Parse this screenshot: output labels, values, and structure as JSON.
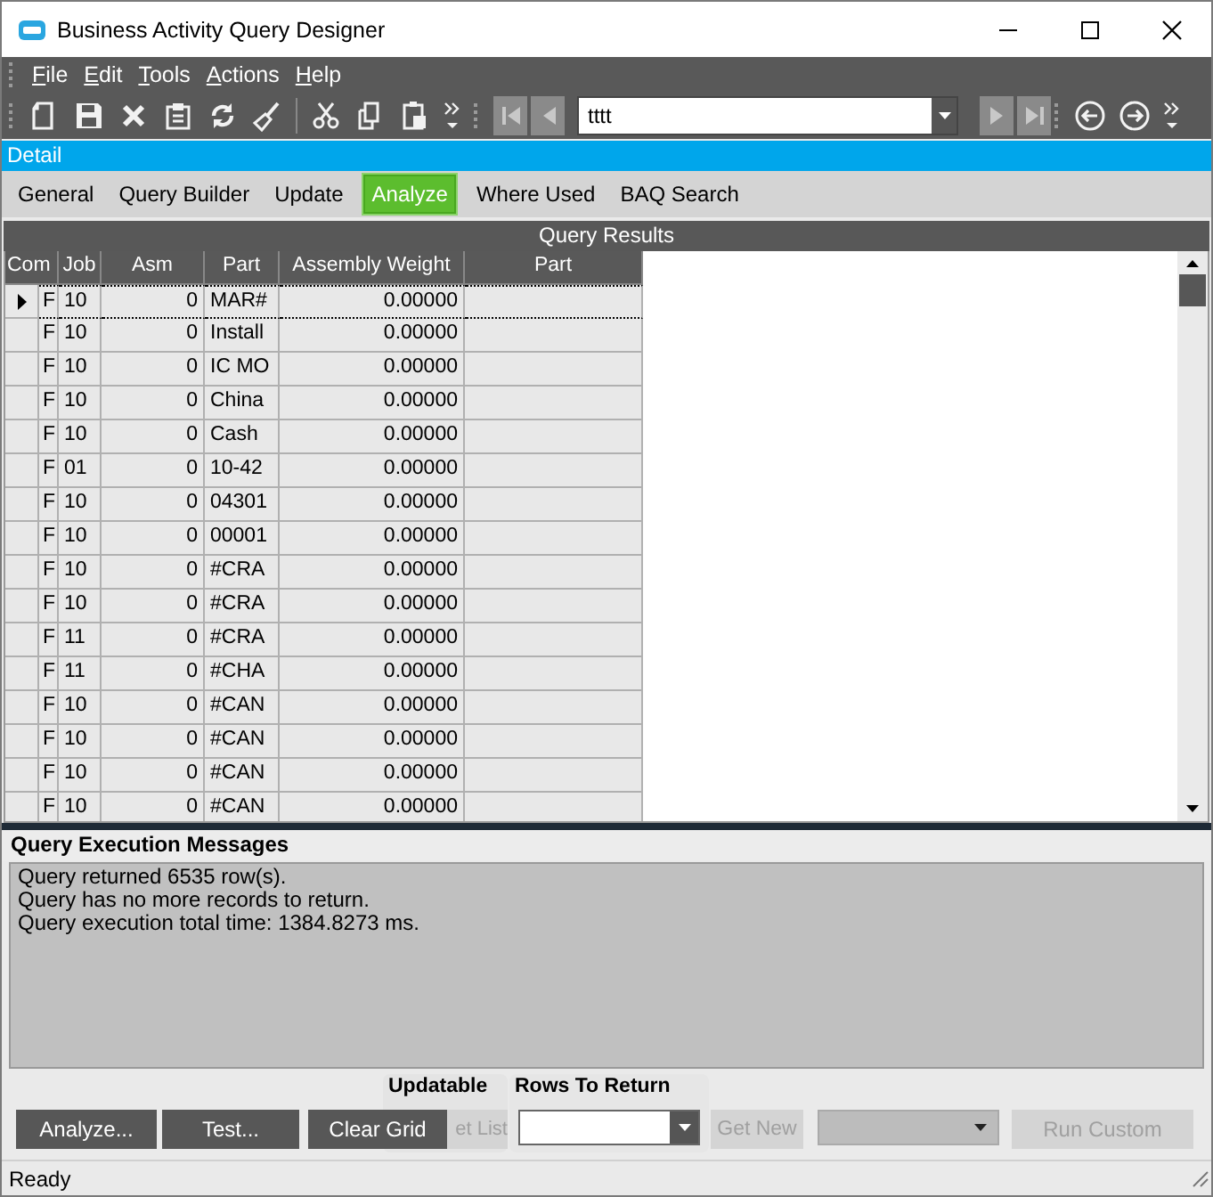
{
  "window": {
    "title": "Business Activity Query Designer"
  },
  "menu": [
    {
      "label": "File"
    },
    {
      "label": "Edit"
    },
    {
      "label": "Tools"
    },
    {
      "label": "Actions"
    },
    {
      "label": "Help"
    }
  ],
  "toolbar": {
    "record_field": {
      "value": "tttt"
    }
  },
  "section_bar": {
    "title": "Detail"
  },
  "tabs": [
    {
      "label": "General",
      "selected": false
    },
    {
      "label": "Query Builder",
      "selected": false
    },
    {
      "label": "Update",
      "selected": false
    },
    {
      "label": "Analyze",
      "selected": true
    },
    {
      "label": "Where Used",
      "selected": false
    },
    {
      "label": "BAQ Search",
      "selected": false
    }
  ],
  "results": {
    "title": "Query Results",
    "columns": [
      {
        "label": "Com"
      },
      {
        "label": "Job"
      },
      {
        "label": "Asm"
      },
      {
        "label": "Part"
      },
      {
        "label": "Assembly Weight"
      },
      {
        "label": "Part"
      }
    ],
    "rows": [
      {
        "current": true,
        "cells": [
          "F",
          "10",
          "0",
          "MAR#",
          "0.00000",
          ""
        ]
      },
      {
        "current": false,
        "cells": [
          "F",
          "10",
          "0",
          "Install",
          "0.00000",
          ""
        ]
      },
      {
        "current": false,
        "cells": [
          "F",
          "10",
          "0",
          "IC MO",
          "0.00000",
          ""
        ]
      },
      {
        "current": false,
        "cells": [
          "F",
          "10",
          "0",
          "China",
          "0.00000",
          ""
        ]
      },
      {
        "current": false,
        "cells": [
          "F",
          "10",
          "0",
          "Cash",
          "0.00000",
          ""
        ]
      },
      {
        "current": false,
        "cells": [
          "F",
          "01",
          "0",
          "10-42",
          "0.00000",
          ""
        ]
      },
      {
        "current": false,
        "cells": [
          "F",
          "10",
          "0",
          "04301",
          "0.00000",
          ""
        ]
      },
      {
        "current": false,
        "cells": [
          "F",
          "10",
          "0",
          "00001",
          "0.00000",
          ""
        ]
      },
      {
        "current": false,
        "cells": [
          "F",
          "10",
          "0",
          "#CRA",
          "0.00000",
          ""
        ]
      },
      {
        "current": false,
        "cells": [
          "F",
          "10",
          "0",
          "#CRA",
          "0.00000",
          ""
        ]
      },
      {
        "current": false,
        "cells": [
          "F",
          "11",
          "0",
          "#CRA",
          "0.00000",
          ""
        ]
      },
      {
        "current": false,
        "cells": [
          "F",
          "11",
          "0",
          "#CHA",
          "0.00000",
          ""
        ]
      },
      {
        "current": false,
        "cells": [
          "F",
          "10",
          "0",
          "#CAN",
          "0.00000",
          ""
        ]
      },
      {
        "current": false,
        "cells": [
          "F",
          "10",
          "0",
          "#CAN",
          "0.00000",
          ""
        ]
      },
      {
        "current": false,
        "cells": [
          "F",
          "10",
          "0",
          "#CAN",
          "0.00000",
          ""
        ]
      },
      {
        "current": false,
        "cells": [
          "F",
          "10",
          "0",
          "#CAN",
          "0.00000",
          ""
        ]
      }
    ]
  },
  "messages": {
    "title": "Query Execution Messages",
    "lines": [
      "Query returned 6535 row(s).",
      "Query has no more records to return.",
      "Query execution total time: 1384.8273 ms."
    ]
  },
  "actions": {
    "updatable_panel": {
      "title": "Updatable"
    },
    "rows_panel": {
      "title": "Rows To Return"
    },
    "buttons": [
      {
        "label": "Analyze...",
        "disabled": false
      },
      {
        "label": "Test...",
        "disabled": false
      },
      {
        "label": "Clear Grid",
        "disabled": false
      },
      {
        "label": "et List",
        "disabled": true
      },
      {
        "label": "Get New",
        "disabled": true
      },
      {
        "label": "Run Custom",
        "disabled": true
      }
    ],
    "custom_combo": {
      "disabled": true
    }
  },
  "status_bar": {
    "text": "Ready"
  }
}
